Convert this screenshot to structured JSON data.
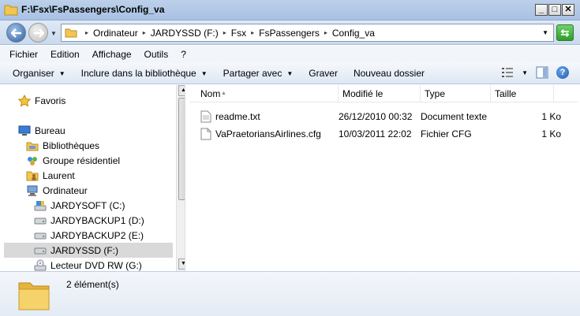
{
  "window": {
    "title": "F:\\Fsx\\FsPassengers\\Config_va"
  },
  "address": {
    "crumbs": [
      "Ordinateur",
      "JARDYSSD (F:)",
      "Fsx",
      "FsPassengers",
      "Config_va"
    ]
  },
  "menu": [
    "Fichier",
    "Edition",
    "Affichage",
    "Outils",
    "?"
  ],
  "toolbar": {
    "organize": "Organiser",
    "include": "Inclure dans la bibliothèque",
    "share": "Partager avec",
    "burn": "Graver",
    "new_folder": "Nouveau dossier"
  },
  "nav": {
    "favorites": "Favoris",
    "desktop": "Bureau",
    "libraries": "Bibliothèques",
    "homegroup": "Groupe résidentiel",
    "user": "Laurent",
    "computer": "Ordinateur",
    "drives": [
      "JARDYSOFT (C:)",
      "JARDYBACKUP1 (D:)",
      "JARDYBACKUP2 (E:)",
      "JARDYSSD (F:)",
      "Lecteur DVD RW (G:)"
    ]
  },
  "columns": {
    "name": "Nom",
    "modified": "Modifié le",
    "type": "Type",
    "size": "Taille"
  },
  "files": [
    {
      "name": "readme.txt",
      "modified": "26/12/2010 00:32",
      "type": "Document texte",
      "size": "1 Ko"
    },
    {
      "name": "VaPraetoriansAirlines.cfg",
      "modified": "10/03/2011 22:02",
      "type": "Fichier CFG",
      "size": "1 Ko"
    }
  ],
  "status": {
    "count": "2 élément(s)"
  },
  "colors": {
    "selected": "#d9d9d9",
    "folder": "#f3c64f"
  }
}
